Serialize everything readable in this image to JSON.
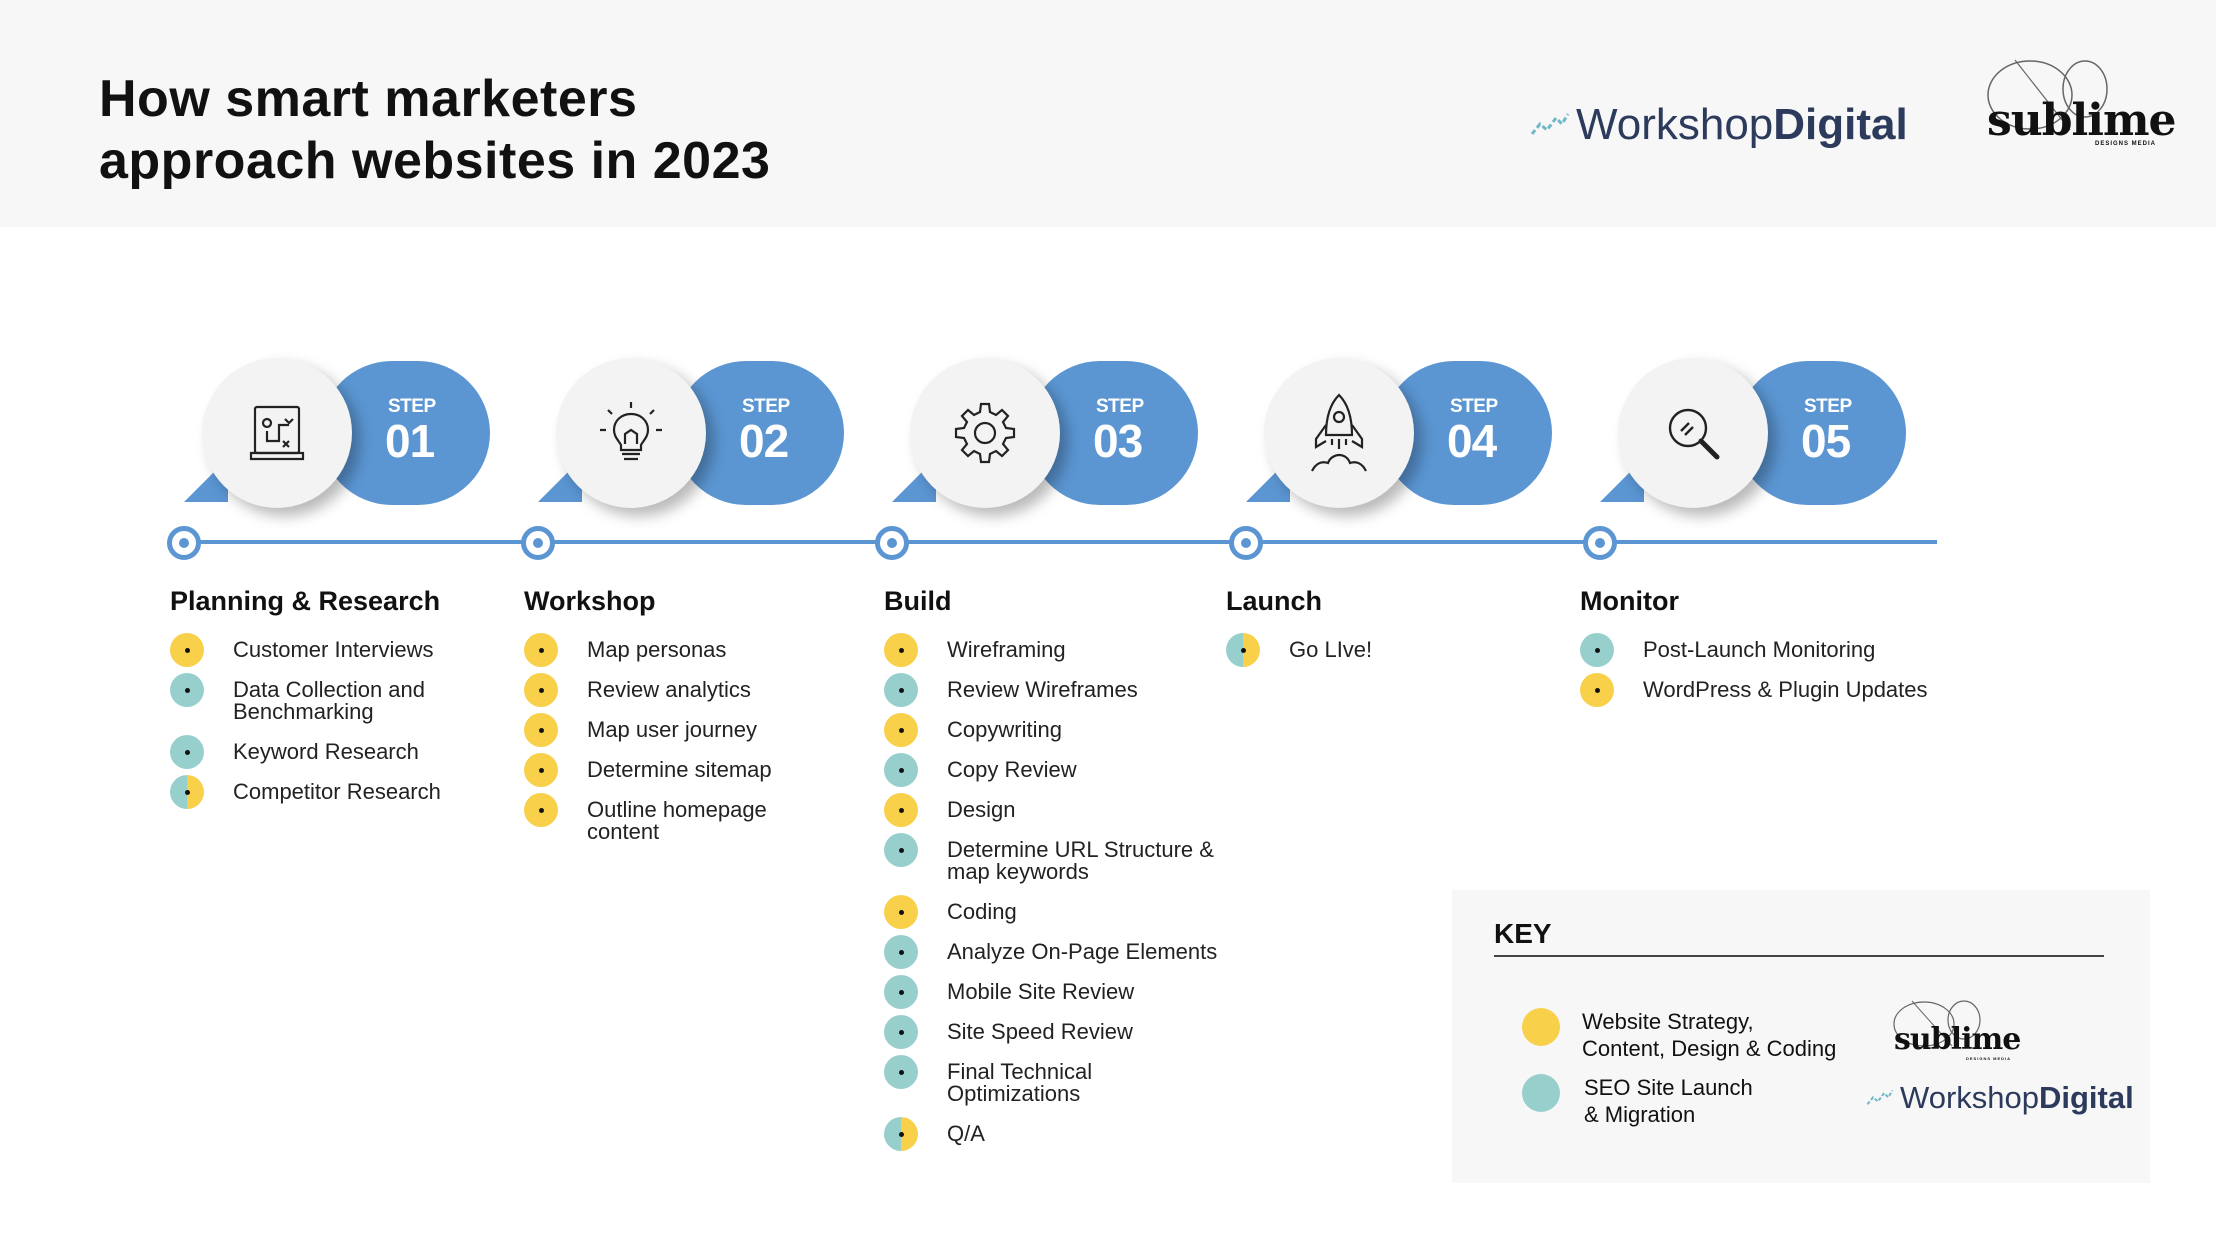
{
  "header": {
    "title_line1": "How smart marketers",
    "title_line2": "approach websites in 2023",
    "workshop_logo_part1": "Workshop",
    "workshop_logo_part2": "Digital",
    "sublime_logo_word": "sublime",
    "sublime_logo_tag": "DESIGNS MEDIA"
  },
  "colors": {
    "accent_blue": "#5b96d3",
    "yellow": "#f9d04a",
    "teal": "#97cfcd",
    "header_bg": "#f7f7f7"
  },
  "steps": [
    {
      "label": "STEP",
      "number": "01",
      "icon": "document-plan-icon",
      "title": "Planning & Research",
      "items": [
        {
          "text": "Customer Interviews",
          "type": "y"
        },
        {
          "text": "Data Collection and",
          "text2": "Benchmarking",
          "type": "t"
        },
        {
          "text": "Keyword Research",
          "type": "t"
        },
        {
          "text": "Competitor Research",
          "type": "ty"
        }
      ]
    },
    {
      "label": "STEP",
      "number": "02",
      "icon": "lightbulb-icon",
      "title": "Workshop",
      "items": [
        {
          "text": "Map personas",
          "type": "y"
        },
        {
          "text": "Review analytics",
          "type": "y"
        },
        {
          "text": "Map user journey",
          "type": "y"
        },
        {
          "text": "Determine sitemap",
          "type": "y"
        },
        {
          "text": "Outline homepage",
          "text2": "content",
          "type": "y"
        }
      ]
    },
    {
      "label": "STEP",
      "number": "03",
      "icon": "gear-icon",
      "title": "Build",
      "items": [
        {
          "text": "Wireframing",
          "type": "y"
        },
        {
          "text": "Review Wireframes",
          "type": "t"
        },
        {
          "text": "Copywriting",
          "type": "y"
        },
        {
          "text": "Copy Review",
          "type": "t"
        },
        {
          "text": "Design",
          "type": "y"
        },
        {
          "text": "Determine URL Structure &",
          "text2": "map keywords",
          "type": "t"
        },
        {
          "text": "Coding",
          "type": "y"
        },
        {
          "text": "Analyze On-Page Elements",
          "type": "t"
        },
        {
          "text": "Mobile Site Review",
          "type": "t"
        },
        {
          "text": "Site Speed Review",
          "type": "t"
        },
        {
          "text": "Final Technical",
          "text2": "Optimizations",
          "type": "t"
        },
        {
          "text": "Q/A",
          "type": "ty"
        }
      ]
    },
    {
      "label": "STEP",
      "number": "04",
      "icon": "rocket-icon",
      "title": "Launch",
      "items": [
        {
          "text": "Go LIve!",
          "type": "ty"
        }
      ]
    },
    {
      "label": "STEP",
      "number": "05",
      "icon": "magnifier-icon",
      "title": "Monitor",
      "items": [
        {
          "text": "Post-Launch Monitoring",
          "type": "t"
        },
        {
          "text": "WordPress & Plugin Updates",
          "type": "y"
        }
      ]
    }
  ],
  "key": {
    "title": "KEY",
    "row1_line1": "Website Strategy,",
    "row1_line2": "Content, Design & Coding",
    "row2_line1": "SEO Site Launch",
    "row2_line2": "& Migration"
  }
}
